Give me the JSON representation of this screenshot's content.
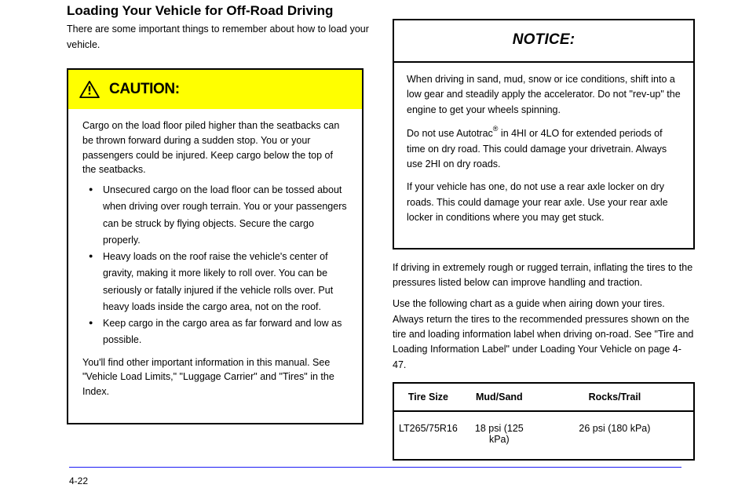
{
  "left": {
    "heading": "Loading Your Vehicle for Off-Road Driving",
    "para1": "There are some important things to remember about how to load your vehicle.",
    "caution": {
      "label": "CAUTION:",
      "lead": "Cargo on the load floor piled higher than the seatbacks can be thrown forward during a sudden stop. You or your passengers could be injured. Keep cargo below the top of the seatbacks.",
      "bullets": [
        "Unsecured cargo on the load floor can be tossed about when driving over rough terrain. You or your passengers can be struck by flying objects. Secure the cargo properly.",
        "Heavy loads on the roof raise the vehicle's center of gravity, making it more likely to roll over. You can be seriously or fatally injured if the vehicle rolls over. Put heavy loads inside the cargo area, not on the roof.",
        "Keep cargo in the cargo area as far forward and low as possible."
      ],
      "trail": "You'll find other important information in this manual. See \"Vehicle Load Limits,\" \"Luggage Carrier\" and \"Tires\" in the Index."
    }
  },
  "right": {
    "notice_head": "NOTICE:",
    "notice_p1": "When driving in sand, mud, snow or ice conditions, shift into a low gear and steadily apply the accelerator. Do not \"rev-up\" the engine to get your wheels spinning.",
    "notice_p2_a": "Do not use Autotrac",
    "notice_p2_b": " in 4HI or 4LO for extended periods of time on dry road. This could damage your drivetrain. Always use 2HI on dry roads.",
    "notice_p3": "If your vehicle has one, do not use a rear axle locker on dry roads. This could damage your rear axle. Use your rear axle locker in conditions where you may get stuck.",
    "after1": "If driving in extremely rough or rugged terrain, inflating the tires to the pressures listed below can improve handling and traction.",
    "after2": "Use the following chart as a guide when airing down your tires. Always return the tires to the recommended pressures shown on the tire and loading information label when driving on-road. See \"Tire and Loading Information Label\" under Loading Your Vehicle on page 4-47.",
    "table": {
      "h1": "Tire Size",
      "h2": "Mud/Sand",
      "h3": "Rocks/Trail",
      "c1": "LT265/75R16",
      "c2": "18 psi (125 kPa)",
      "c3": "26 psi (180 kPa)"
    }
  },
  "page_number": "4-22"
}
